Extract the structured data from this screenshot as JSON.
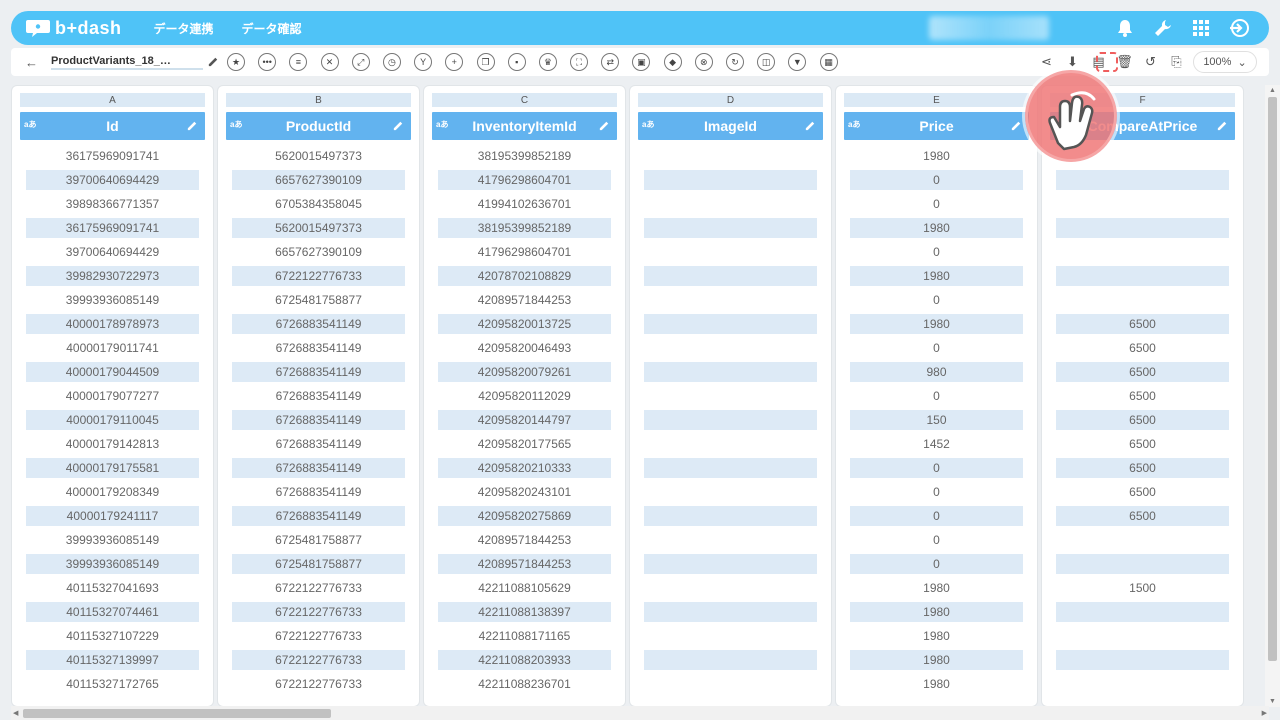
{
  "app": {
    "logo_text": "b+dash"
  },
  "nav": {
    "items": [
      "データ連携",
      "データ確認"
    ]
  },
  "toolbar": {
    "file_name": "ProductVariants_18_…",
    "zoom": "100%"
  },
  "columns": [
    {
      "letter": "A",
      "title": "Id",
      "type": "aあ",
      "cells": [
        "36175969091741",
        "39700640694429",
        "39898366771357",
        "36175969091741",
        "39700640694429",
        "39982930722973",
        "39993936085149",
        "40000178978973",
        "40000179011741",
        "40000179044509",
        "40000179077277",
        "40000179110045",
        "40000179142813",
        "40000179175581",
        "40000179208349",
        "40000179241117",
        "39993936085149",
        "39993936085149",
        "40115327041693",
        "40115327074461",
        "40115327107229",
        "40115327139997",
        "40115327172765"
      ]
    },
    {
      "letter": "B",
      "title": "ProductId",
      "type": "aあ",
      "cells": [
        "5620015497373",
        "6657627390109",
        "6705384358045",
        "5620015497373",
        "6657627390109",
        "6722122776733",
        "6725481758877",
        "6726883541149",
        "6726883541149",
        "6726883541149",
        "6726883541149",
        "6726883541149",
        "6726883541149",
        "6726883541149",
        "6726883541149",
        "6726883541149",
        "6725481758877",
        "6725481758877",
        "6722122776733",
        "6722122776733",
        "6722122776733",
        "6722122776733",
        "6722122776733"
      ]
    },
    {
      "letter": "C",
      "title": "InventoryItemId",
      "type": "aあ",
      "cells": [
        "38195399852189",
        "41796298604701",
        "41994102636701",
        "38195399852189",
        "41796298604701",
        "42078702108829",
        "42089571844253",
        "42095820013725",
        "42095820046493",
        "42095820079261",
        "42095820112029",
        "42095820144797",
        "42095820177565",
        "42095820210333",
        "42095820243101",
        "42095820275869",
        "42089571844253",
        "42089571844253",
        "42211088105629",
        "42211088138397",
        "42211088171165",
        "42211088203933",
        "42211088236701"
      ]
    },
    {
      "letter": "D",
      "title": "ImageId",
      "type": "aあ",
      "cells": [
        "",
        "",
        "",
        "",
        "",
        "",
        "",
        "",
        "",
        "",
        "",
        "",
        "",
        "",
        "",
        "",
        "",
        "",
        "",
        "",
        "",
        "",
        ""
      ]
    },
    {
      "letter": "E",
      "title": "Price",
      "type": "aあ",
      "cells": [
        "1980",
        "0",
        "0",
        "1980",
        "0",
        "1980",
        "0",
        "1980",
        "0",
        "980",
        "0",
        "150",
        "1452",
        "0",
        "0",
        "0",
        "0",
        "0",
        "1980",
        "1980",
        "1980",
        "1980",
        "1980"
      ]
    },
    {
      "letter": "F",
      "title": "CompareAtPrice",
      "type": "aあ",
      "cells": [
        "",
        "",
        "",
        "",
        "",
        "",
        "",
        "6500",
        "6500",
        "6500",
        "6500",
        "6500",
        "6500",
        "6500",
        "6500",
        "6500",
        "",
        "",
        "1500",
        "",
        "",
        "",
        ""
      ]
    }
  ]
}
